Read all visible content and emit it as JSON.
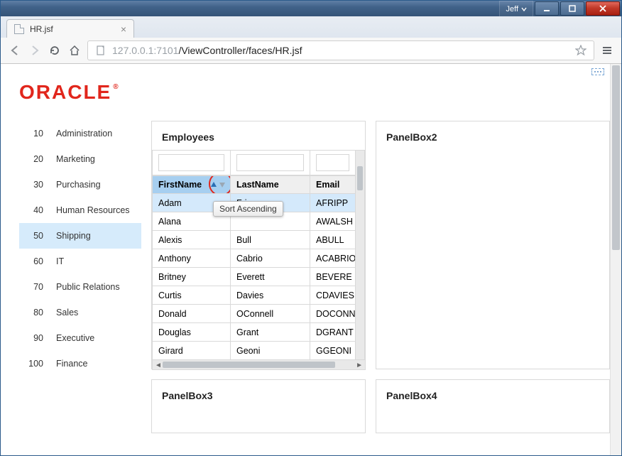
{
  "window": {
    "user": "Jeff"
  },
  "browser": {
    "tab_title": "HR.jsf",
    "url_host": "127.0.0.1",
    "url_port": ":7101",
    "url_path": "/ViewController/faces/HR.jsf"
  },
  "logo_text": "ORACLE",
  "sidebar": {
    "items": [
      {
        "index": "10",
        "label": "Administration",
        "selected": false
      },
      {
        "index": "20",
        "label": "Marketing",
        "selected": false
      },
      {
        "index": "30",
        "label": "Purchasing",
        "selected": false
      },
      {
        "index": "40",
        "label": "Human Resources",
        "selected": false
      },
      {
        "index": "50",
        "label": "Shipping",
        "selected": true
      },
      {
        "index": "60",
        "label": "IT",
        "selected": false
      },
      {
        "index": "70",
        "label": "Public Relations",
        "selected": false
      },
      {
        "index": "80",
        "label": "Sales",
        "selected": false
      },
      {
        "index": "90",
        "label": "Executive",
        "selected": false
      },
      {
        "index": "100",
        "label": "Finance",
        "selected": false
      }
    ]
  },
  "panels": {
    "employees_title": "Employees",
    "panel2_title": "PanelBox2",
    "panel3_title": "PanelBox3",
    "panel4_title": "PanelBox4"
  },
  "table": {
    "sort_tooltip": "Sort Ascending",
    "columns": {
      "first": "FirstName",
      "last": "LastName",
      "email": "Email"
    },
    "rows": [
      {
        "first": "Adam",
        "last": "Fripp",
        "email": "AFRIPP",
        "selected": true
      },
      {
        "first": "Alana",
        "last": "",
        "email": "AWALSH",
        "selected": false
      },
      {
        "first": "Alexis",
        "last": "Bull",
        "email": "ABULL",
        "selected": false
      },
      {
        "first": "Anthony",
        "last": "Cabrio",
        "email": "ACABRIO",
        "selected": false
      },
      {
        "first": "Britney",
        "last": "Everett",
        "email": "BEVERE",
        "selected": false
      },
      {
        "first": "Curtis",
        "last": "Davies",
        "email": "CDAVIES",
        "selected": false
      },
      {
        "first": "Donald",
        "last": "OConnell",
        "email": "DOCONN",
        "selected": false
      },
      {
        "first": "Douglas",
        "last": "Grant",
        "email": "DGRANT",
        "selected": false
      },
      {
        "first": "Girard",
        "last": "Geoni",
        "email": "GGEONI",
        "selected": false
      }
    ]
  }
}
